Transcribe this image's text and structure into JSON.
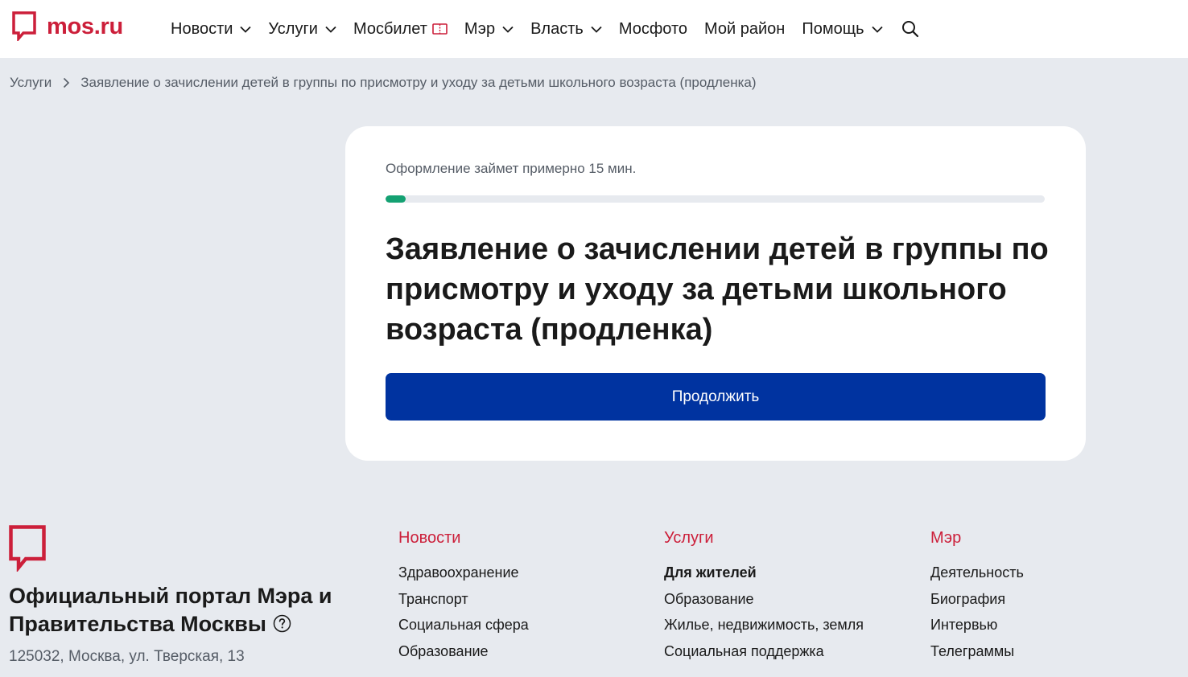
{
  "header": {
    "logo_text": "mos.ru",
    "nav": [
      {
        "label": "Новости",
        "dropdown": true
      },
      {
        "label": "Услуги",
        "dropdown": true
      },
      {
        "label": "Мосбилет",
        "dropdown": false
      },
      {
        "label": "Мэр",
        "dropdown": true
      },
      {
        "label": "Власть",
        "dropdown": true
      },
      {
        "label": "Мосфото",
        "dropdown": false
      },
      {
        "label": "Мой район",
        "dropdown": false
      },
      {
        "label": "Помощь",
        "dropdown": true
      }
    ]
  },
  "breadcrumb": {
    "root": "Услуги",
    "current": "Заявление о зачислении детей в группы по присмотру и уходу за детьми школьного возраста (продленка)"
  },
  "card": {
    "duration": "Оформление займет примерно 15 мин.",
    "progress_percent": 3,
    "title": "Заявление о зачислении детей в группы по присмотру и уходу за детьми школьного возраста (продленка)",
    "button_label": "Продолжить"
  },
  "footer": {
    "title": "Официальный портал Мэра и Правительства Москвы",
    "address": "125032, Москва, ул. Тверская, 13",
    "columns": [
      {
        "title": "Новости",
        "items": [
          "Здравоохранение",
          "Транспорт",
          "Социальная сфера",
          "Образование"
        ]
      },
      {
        "title": "Услуги",
        "items": [
          "Для жителей",
          "Образование",
          "Жилье, недвижимость, земля",
          "Социальная поддержка"
        ]
      },
      {
        "title": "Мэр",
        "items": [
          "Деятельность",
          "Биография",
          "Интервью",
          "Телеграммы"
        ]
      }
    ]
  },
  "colors": {
    "brand_red": "#cc1f3a",
    "primary_blue": "#0033a0",
    "progress_green": "#14a172",
    "page_background": "#e7eaef"
  },
  "icons": {
    "logo": "speech-bubble-logo-icon",
    "nav_dropdown": "chevron-down-icon",
    "mosbilet": "ticket-icon",
    "search": "search-icon",
    "breadcrumb_separator": "chevron-right-icon",
    "footer_help": "help-circle-icon"
  }
}
